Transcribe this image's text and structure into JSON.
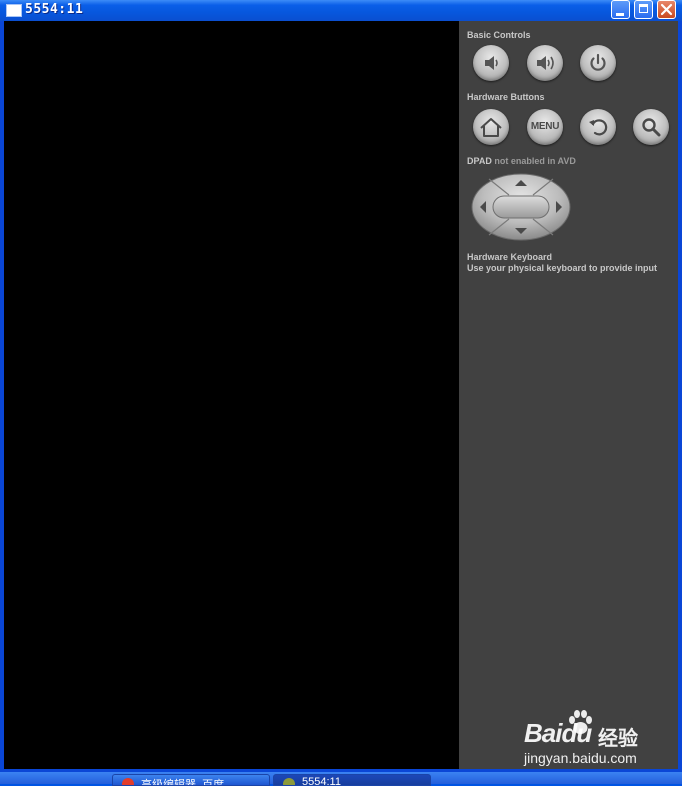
{
  "window": {
    "title": "5554:11"
  },
  "panel": {
    "basic_controls_label": "Basic Controls",
    "hardware_buttons_label": "Hardware Buttons",
    "menu_button_text": "MENU",
    "dpad_label": "DPAD",
    "dpad_status": " not enabled in AVD",
    "keyboard_title": "Hardware Keyboard",
    "keyboard_desc": "Use your physical keyboard to provide input"
  },
  "watermark": {
    "brand": "Baidu",
    "cn": "经验",
    "url": "jingyan.baidu.com"
  },
  "taskbar": {
    "items": [
      {
        "label": "高级编辑器_百度"
      },
      {
        "label": "5554:11"
      }
    ]
  },
  "colors": {
    "panel_bg": "#414141",
    "screen_bg": "#000000",
    "title_blue": "#0a5ee8"
  }
}
